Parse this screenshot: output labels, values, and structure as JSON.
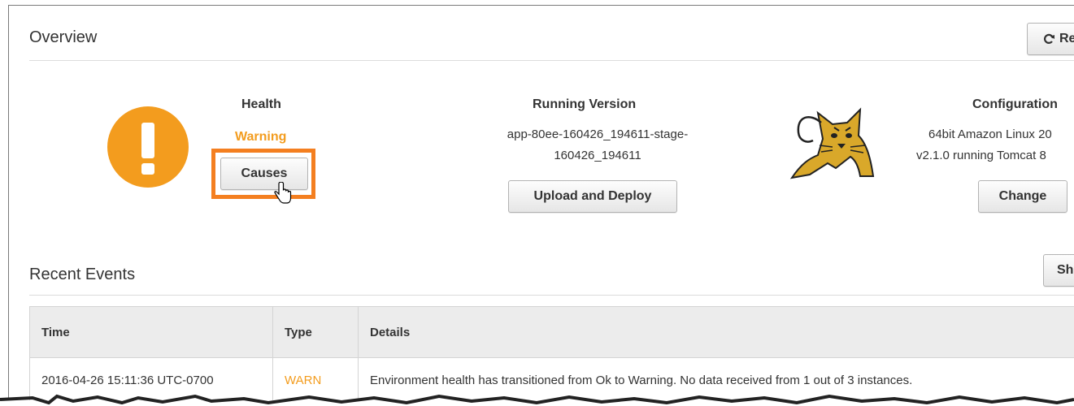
{
  "overview": {
    "title": "Overview",
    "refresh_label": "Re"
  },
  "health": {
    "heading": "Health",
    "status": "Warning",
    "status_color": "#f39c1e",
    "causes_label": "Causes"
  },
  "running_version": {
    "heading": "Running Version",
    "line1": "app-80ee-160426_194611-stage-",
    "line2": "160426_194611",
    "upload_label": "Upload and Deploy"
  },
  "configuration": {
    "heading": "Configuration",
    "line1": "64bit Amazon Linux 20",
    "line2": "v2.1.0 running Tomcat 8",
    "change_label": "Change"
  },
  "recent_events": {
    "title": "Recent Events",
    "show_label": "Sh",
    "columns": [
      "Time",
      "Type",
      "Details"
    ],
    "rows": [
      {
        "time": "2016-04-26 15:11:36 UTC-0700",
        "type": "WARN",
        "details": "Environment health has transitioned from Ok to Warning. No data received from 1 out of 3 instances."
      }
    ]
  },
  "colors": {
    "accent_orange": "#f47f20",
    "warning": "#f39c1e",
    "tomcat_yellow": "#d9a82a"
  },
  "icons": {
    "health_icon": "exclamation-circle-icon",
    "config_icon": "tomcat-logo-icon",
    "refresh_icon": "refresh-icon",
    "cursor_icon": "hand-pointer-icon"
  }
}
